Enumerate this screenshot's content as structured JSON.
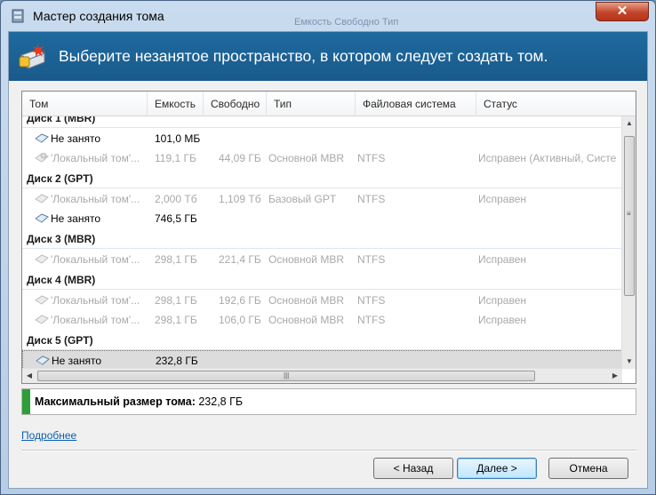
{
  "window": {
    "title": "Мастер создания тома",
    "close_label": "✕"
  },
  "title_ghost": "Емкость     Свободно     Тип",
  "header": {
    "text": "Выберите незанятое пространство, в котором следует создать том."
  },
  "columns": [
    "Том",
    "Емкость",
    "Свободно",
    "Тип",
    "Файловая система",
    "Статус"
  ],
  "groups": [
    {
      "label": "Диск 1 (MBR)"
    },
    {
      "label": "Диск 2 (GPT)"
    },
    {
      "label": "Диск 3 (MBR)"
    },
    {
      "label": "Диск 4 (MBR)"
    },
    {
      "label": "Диск 5 (GPT)"
    }
  ],
  "rows": [
    {
      "name": "Не занято",
      "capacity": "101,0 МБ",
      "free": "",
      "type": "",
      "fs": "",
      "status": ""
    },
    {
      "name": "'Локальный том'...",
      "capacity": "119,1 ГБ",
      "free": "44,09 ГБ",
      "type": "Основной MBR",
      "fs": "NTFS",
      "status": "Исправен (Активный, Систе"
    },
    {
      "name": "'Локальный том'...",
      "capacity": "2,000 Тб",
      "free": "1,109 Тб",
      "type": "Базовый GPT",
      "fs": "NTFS",
      "status": "Исправен"
    },
    {
      "name": "Не занято",
      "capacity": "746,5 ГБ",
      "free": "",
      "type": "",
      "fs": "",
      "status": ""
    },
    {
      "name": "'Локальный том'...",
      "capacity": "298,1 ГБ",
      "free": "221,4 ГБ",
      "type": "Основной MBR",
      "fs": "NTFS",
      "status": "Исправен"
    },
    {
      "name": "'Локальный том'...",
      "capacity": "298,1 ГБ",
      "free": "192,6 ГБ",
      "type": "Основной MBR",
      "fs": "NTFS",
      "status": "Исправен"
    },
    {
      "name": "'Локальный том'...",
      "capacity": "298,1 ГБ",
      "free": "106,0 ГБ",
      "type": "Основной MBR",
      "fs": "NTFS",
      "status": "Исправен"
    },
    {
      "name": "Не занято",
      "capacity": "232,8 ГБ",
      "free": "",
      "type": "",
      "fs": "",
      "status": ""
    }
  ],
  "max_size": {
    "label": "Максимальный размер тома:",
    "value": "232,8 ГБ"
  },
  "more_link": "Подробнее",
  "buttons": {
    "back": "< Назад",
    "next": "Далее >",
    "cancel": "Отмена"
  },
  "colors": {
    "header": "#1e6a9e",
    "accent_bar": "#2e9e3a",
    "link": "#0b5fb4"
  }
}
